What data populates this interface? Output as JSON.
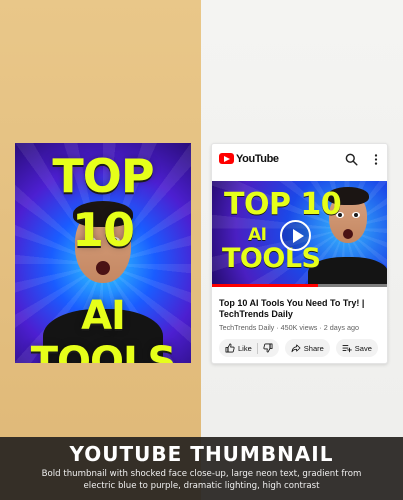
{
  "thumbnail": {
    "headline_top": "TOP 10",
    "headline_bottom": "AI TOOLS"
  },
  "card": {
    "brand": "YouTube",
    "icons": {
      "search": "search-icon",
      "more": "more-vert-icon"
    },
    "preview": {
      "line1": "TOP 10",
      "line2": "AI",
      "line3": "TOOLS",
      "progress_fraction": 0.6
    },
    "video_title": "Top 10 AI Tools You Need To Try! | TechTrends Daily",
    "meta": "TechTrends Daily · 450K views · 2 days ago",
    "actions": {
      "like": "Like",
      "share": "Share",
      "save": "Save"
    }
  },
  "caption": {
    "title": "YOUTUBE THUMBNAIL",
    "description": "Bold thumbnail with shocked face close-up, large neon text, gradient from electric blue to purple, dramatic lighting, high contrast"
  },
  "colors": {
    "neon_text": "#e6ff1a",
    "brand_red": "#ff0000",
    "gradient_start": "#1a5cff",
    "gradient_end": "#4c1fd1"
  }
}
